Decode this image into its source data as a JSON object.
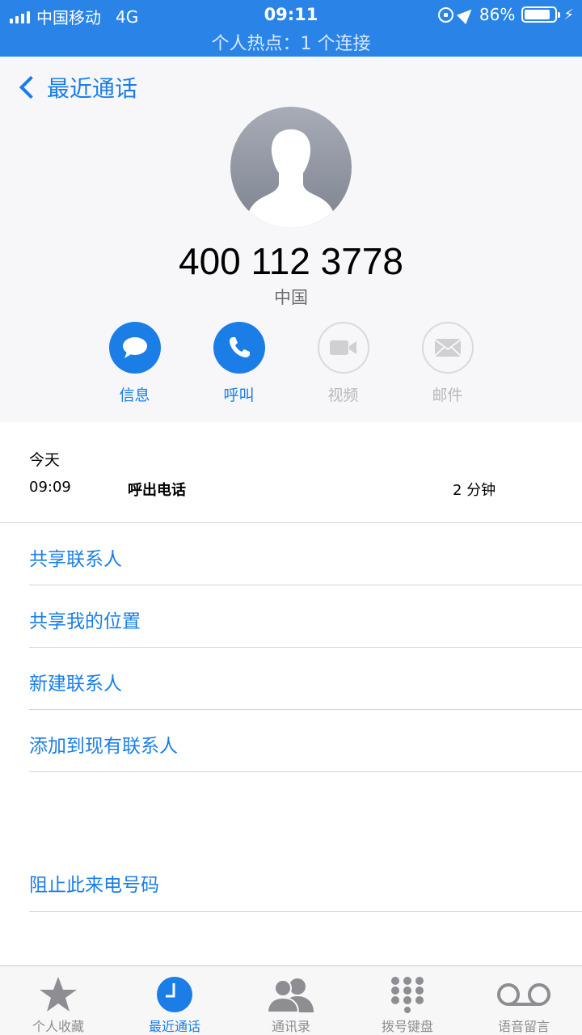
{
  "status_bar": {
    "carrier": "中国移动",
    "network": "4G",
    "time": "09:11",
    "battery": "86%",
    "battery_level": 0.86,
    "hotspot": "个人热点：1 个连接"
  },
  "nav": {
    "back_label": "最近通话"
  },
  "contact": {
    "number": "400 112 3778",
    "region": "中国"
  },
  "actions": [
    {
      "label": "信息",
      "icon": "message-icon",
      "enabled": true
    },
    {
      "label": "呼叫",
      "icon": "phone-icon",
      "enabled": true
    },
    {
      "label": "视频",
      "icon": "video-icon",
      "enabled": false
    },
    {
      "label": "邮件",
      "icon": "mail-icon",
      "enabled": false
    }
  ],
  "call_record": {
    "day": "今天",
    "time": "09:09",
    "type": "呼出电话",
    "duration": "2 分钟"
  },
  "options": [
    "共享联系人",
    "共享我的位置",
    "新建联系人",
    "添加到现有联系人"
  ],
  "block_option": "阻止此来电号码",
  "tabs": [
    {
      "label": "个人收藏",
      "icon": "star-icon",
      "active": false
    },
    {
      "label": "最近通话",
      "icon": "clock-icon",
      "active": true
    },
    {
      "label": "通讯录",
      "icon": "contacts-icon",
      "active": false
    },
    {
      "label": "拨号键盘",
      "icon": "keypad-icon",
      "active": false
    },
    {
      "label": "语音留言",
      "icon": "voicemail-icon",
      "active": false
    }
  ],
  "colors": {
    "accent": "#1a7ee6",
    "status_bar": "#2a84e8",
    "header_bg": "#f7f7f9",
    "disabled": "#b8b8bd"
  }
}
